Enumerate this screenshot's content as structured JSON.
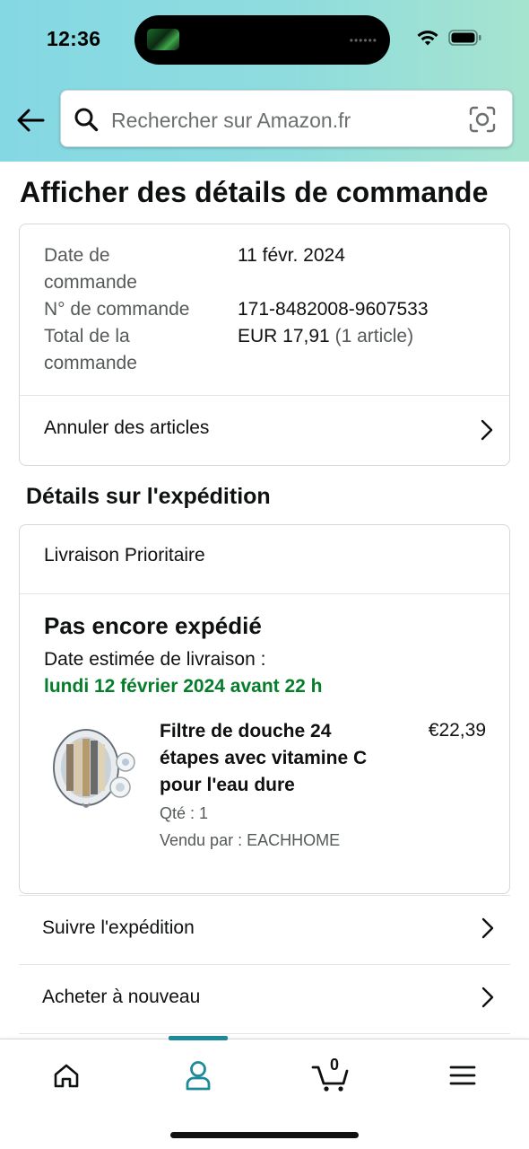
{
  "status_bar": {
    "time": "12:36"
  },
  "search": {
    "placeholder": "Rechercher sur Amazon.fr"
  },
  "page": {
    "title": "Afficher des détails de commande"
  },
  "order": {
    "date_label_1": "Date de",
    "date_label_2": "commande",
    "date_value": "11 févr. 2024",
    "number_label": "N° de commande",
    "number_value": "171-8482008-9607533",
    "total_label_1": "Total de la",
    "total_label_2": "commande",
    "total_value": "EUR 17,91",
    "total_items": "(1 article)",
    "cancel_label": "Annuler des articles"
  },
  "shipping": {
    "section_title": "Détails sur l'expédition",
    "method": "Livraison Prioritaire",
    "status": "Pas encore expédié",
    "eta_label": "Date estimée de livraison :",
    "eta_date": "lundi 12 février 2024 avant 22 h"
  },
  "product": {
    "name": "Filtre de douche 24 étapes avec vitamine C pour l'eau dure",
    "price": "€22,39",
    "qty": "Qté : 1",
    "seller": "Vendu par : EACHHOME"
  },
  "actions": {
    "track": "Suivre l'expédition",
    "buy_again": "Acheter à nouveau"
  },
  "nav": {
    "cart_count": "0",
    "items": [
      "home-icon",
      "account-icon",
      "cart-icon",
      "menu-icon"
    ],
    "active": "account-icon",
    "accent_color": "#1d8a99"
  },
  "colors": {
    "eta_green": "#067d2a",
    "header_gradient_start": "#84d8e4",
    "header_gradient_end": "#a6e4cf"
  }
}
